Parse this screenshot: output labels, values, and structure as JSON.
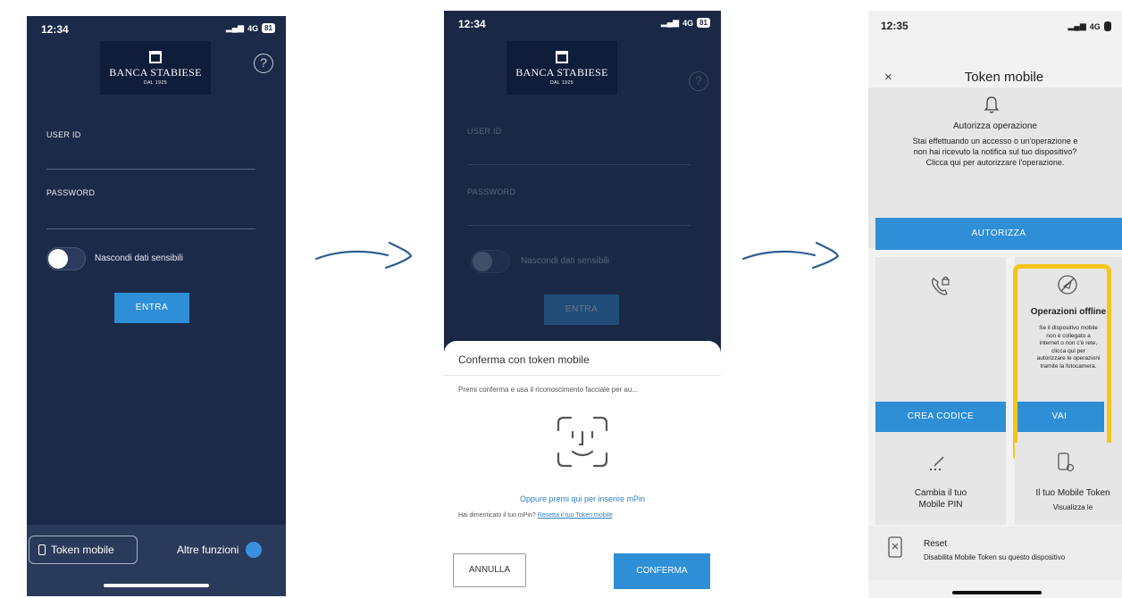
{
  "screen1": {
    "time": "12:34",
    "network": "4G",
    "battery": "81",
    "bank_name": "BANCA STABIESE",
    "bank_since": "DAL 1925",
    "help": "?",
    "user_id_label": "USER ID",
    "password_label": "PASSWORD",
    "toggle_label": "Nascondi dati sensibili",
    "enter_button": "ENTRA",
    "token_button": "Token mobile",
    "other_functions": "Altre funzioni"
  },
  "screen2": {
    "time": "12:34",
    "network": "4G",
    "battery": "81",
    "sheet_title": "Conferma con token mobile",
    "sheet_desc": "Premi conferma e usa il riconoscimento facciale per au...",
    "mpin_link": "Oppure premi qui per inserire mPin",
    "forgot_text": "Hai dimenticato il tuo mPin?",
    "reset_link": "Resetta il tuo Token mobile",
    "cancel_button": "ANNULLA",
    "confirm_button": "CONFERMA"
  },
  "screen3": {
    "time": "12:35",
    "network": "4G",
    "title": "Token mobile",
    "close": "×",
    "authorize_title": "Autorizza operazione",
    "authorize_desc_1": "Stai effettuando un accesso o un'operazione e",
    "authorize_desc_2": "non hai ricevuto la notifica sul tuo dispositivo?",
    "authorize_desc_3": "Clicca qui per autorizzare l'operazione.",
    "authorize_button": "AUTORIZZA",
    "offline_title": "Operazioni offline",
    "offline_desc": [
      "Se il dispositivo mobile",
      "non è collegato a",
      "internet o non c'è rete,",
      "clicca qui per",
      "autorizzare le operazioni",
      "tramite la fotocamera."
    ],
    "create_code_button": "CREA CODICE",
    "go_button": "VAI",
    "change_pin_1": "Cambia il tuo",
    "change_pin_2": "Mobile PIN",
    "your_token": "Il tuo Mobile Token",
    "your_token_sub": "Visualizza le",
    "reset_title": "Reset",
    "reset_desc": "Disabilita Mobile Token su questo dispositivo"
  },
  "colors": {
    "navy": "#1b2a48",
    "accent_blue": "#2f8fd6",
    "highlight_yellow": "#f5c518",
    "arrow": "#2f5f8f"
  }
}
